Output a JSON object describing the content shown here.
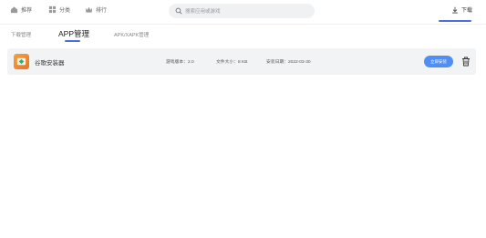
{
  "nav": {
    "items": [
      {
        "label": "推荐",
        "icon": "home-icon"
      },
      {
        "label": "分类",
        "icon": "grid-icon"
      },
      {
        "label": "排行",
        "icon": "crown-icon"
      }
    ],
    "search_placeholder": "搜索应用或游戏",
    "download_label": "下载"
  },
  "tabs": [
    {
      "label": "下载管理"
    },
    {
      "label": "APP管理"
    },
    {
      "label": "APK/XAPK管理"
    }
  ],
  "app": {
    "name": "谷歌安装器",
    "version_key": "游戏版本：",
    "version_val": "2.0",
    "size_key": "文件大小：",
    "size_val": "8 KB",
    "date_key": "安装日期：",
    "date_val": "2022-03-30",
    "install_label": "立即安装"
  },
  "colors": {
    "accent": "#4a6ee0",
    "button": "#4e8ef5",
    "row_bg": "#f2f3f5"
  }
}
